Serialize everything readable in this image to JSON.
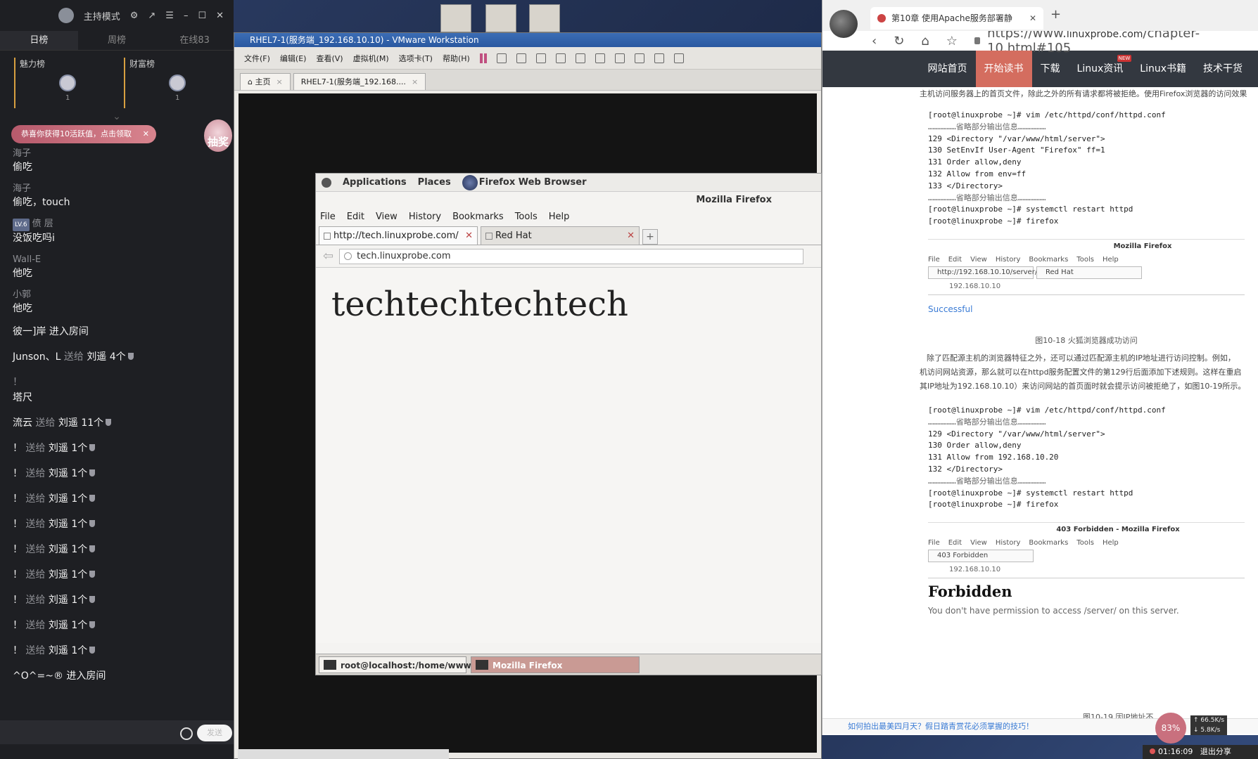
{
  "stream": {
    "host_mode": "主持模式",
    "tabs": [
      "日榜",
      "周榜",
      "在线83"
    ],
    "rank_labels": [
      "魅力榜",
      "财富榜"
    ],
    "rank_nums": [
      "1",
      "1"
    ],
    "banner": "恭喜你获得10活跃值，点击领取",
    "lottery": "抽奖",
    "messages": [
      {
        "name": "海子",
        "text": "偷吃"
      },
      {
        "name": "海子",
        "text": "偷吃，touch"
      },
      {
        "name": "偾 层",
        "text": "没饭吃吗i",
        "badge": "LV.6"
      },
      {
        "name": "Wall-E",
        "text": "他吃"
      },
      {
        "name": "小郭",
        "text": "他吃"
      }
    ],
    "enter1": "彼一]岸 进入房间",
    "gifts": [
      {
        "user": "Junson、L",
        "action": "送给",
        "target": "刘遥 4个"
      },
      {
        "user": "！",
        "action": "",
        "target": "塔尺",
        "note": true
      },
      {
        "user": "流云",
        "action": "送给",
        "target": "刘遥 11个"
      },
      {
        "user": "！",
        "action": "送给",
        "target": "刘遥 1个"
      },
      {
        "user": "！",
        "action": "送给",
        "target": "刘遥 1个"
      },
      {
        "user": "！",
        "action": "送给",
        "target": "刘遥 1个"
      },
      {
        "user": "！",
        "action": "送给",
        "target": "刘遥 1个"
      },
      {
        "user": "！",
        "action": "送给",
        "target": "刘遥 1个"
      },
      {
        "user": "！",
        "action": "送给",
        "target": "刘遥 1个"
      },
      {
        "user": "！",
        "action": "送给",
        "target": "刘遥 1个"
      },
      {
        "user": "！",
        "action": "送给",
        "target": "刘遥 1个"
      },
      {
        "user": "！",
        "action": "送给",
        "target": "刘遥 1个"
      }
    ],
    "enter2": "^O^=~® 进入房间",
    "send": "发送"
  },
  "vmware": {
    "title": "RHEL7-1(服务端_192.168.10.10) - VMware Workstation",
    "menu": [
      "文件(F)",
      "编辑(E)",
      "查看(V)",
      "虚拟机(M)",
      "选项卡(T)",
      "帮助(H)"
    ],
    "tabs": [
      "主页",
      "RHEL7-1(服务端_192.168...."
    ]
  },
  "guest": {
    "panel": [
      "Applications",
      "Places",
      "Firefox Web Browser"
    ],
    "window_title": "Mozilla Firefox",
    "menu": [
      "File",
      "Edit",
      "View",
      "History",
      "Bookmarks",
      "Tools",
      "Help"
    ],
    "tab1": "http://tech.linuxprobe.com/",
    "tab2": "Red Hat",
    "url": "tech.linuxprobe.com",
    "body": "techtechtechtech",
    "task1": "root@localhost:/home/wwwroot",
    "task2": "Mozilla Firefox"
  },
  "host": {
    "tab_title": "第10章 使用Apache服务部署静",
    "url_prefix": "https://www.",
    "url_domain": "linuxprobe.com",
    "url_path": "/chapter-10.html#105",
    "menu": [
      "网站首页",
      "开始读书",
      "下载",
      "Linux资讯",
      "Linux书籍",
      "技术干货"
    ],
    "new_badge": "NEW",
    "intro": "主机访问服务器上的首页文件，除此之外的所有请求都将被拒绝。使用Firefox浏览器的访问效果",
    "code1": [
      "[root@linuxprobe ~]# vim /etc/httpd/conf/httpd.conf",
      "………………省略部分输出信息………………",
      "129 <Directory \"/var/www/html/server\">",
      "130 SetEnvIf User-Agent \"Firefox\" ff=1",
      "131 Order allow,deny",
      "132 Allow from env=ff",
      "133 </Directory>",
      "………………省略部分输出信息………………",
      "[root@linuxprobe ~]# systemctl restart httpd",
      "[root@linuxprobe ~]# firefox"
    ],
    "shot1_title": "Mozilla Firefox",
    "shot_menu": [
      "File",
      "Edit",
      "View",
      "History",
      "Bookmarks",
      "Tools",
      "Help"
    ],
    "shot1_tab1": "http://192.168.10.10/server/",
    "shot1_tab2": "Red Hat",
    "shot1_url": "192.168.10.10",
    "shot1_result": "Successful",
    "fig1": "图10-18  火狐浏览器成功访问",
    "para": [
      "除了匹配源主机的浏览器特征之外，还可以通过匹配源主机的IP地址进行访问控制。例如，",
      "机访问网站资源，那么就可以在httpd服务配置文件的第129行后面添加下述规则。这样在重启",
      "其IP地址为192.168.10.10）来访问网站的首页面时就会提示访问被拒绝了，如图10-19所示。"
    ],
    "code2": [
      "[root@linuxprobe ~]# vim /etc/httpd/conf/httpd.conf",
      "………………省略部分输出信息………………",
      "129 <Directory \"/var/www/html/server\">",
      "130 Order allow,deny",
      "131 Allow from 192.168.10.20",
      "132 </Directory>",
      "………………省略部分输出信息………………",
      "[root@linuxprobe ~]# systemctl restart httpd",
      "[root@linuxprobe ~]# firefox"
    ],
    "shot2_title": "403 Forbidden - Mozilla Firefox",
    "shot2_tab": "403 Forbidden",
    "shot2_url": "192.168.10.10",
    "forbidden_h": "Forbidden",
    "forbidden_p": "You don't have permission to access /server/ on this server.",
    "fig2": "图10-19  因IP地址不",
    "bottom_link": "如何拍出最美四月天？假日踏青赏花必须掌握的技巧！"
  },
  "tray": {
    "cpu": "83%",
    "up": "66.5K/s",
    "down": "5.8K/s",
    "timer": "01:16:09",
    "exit": "退出分享"
  }
}
